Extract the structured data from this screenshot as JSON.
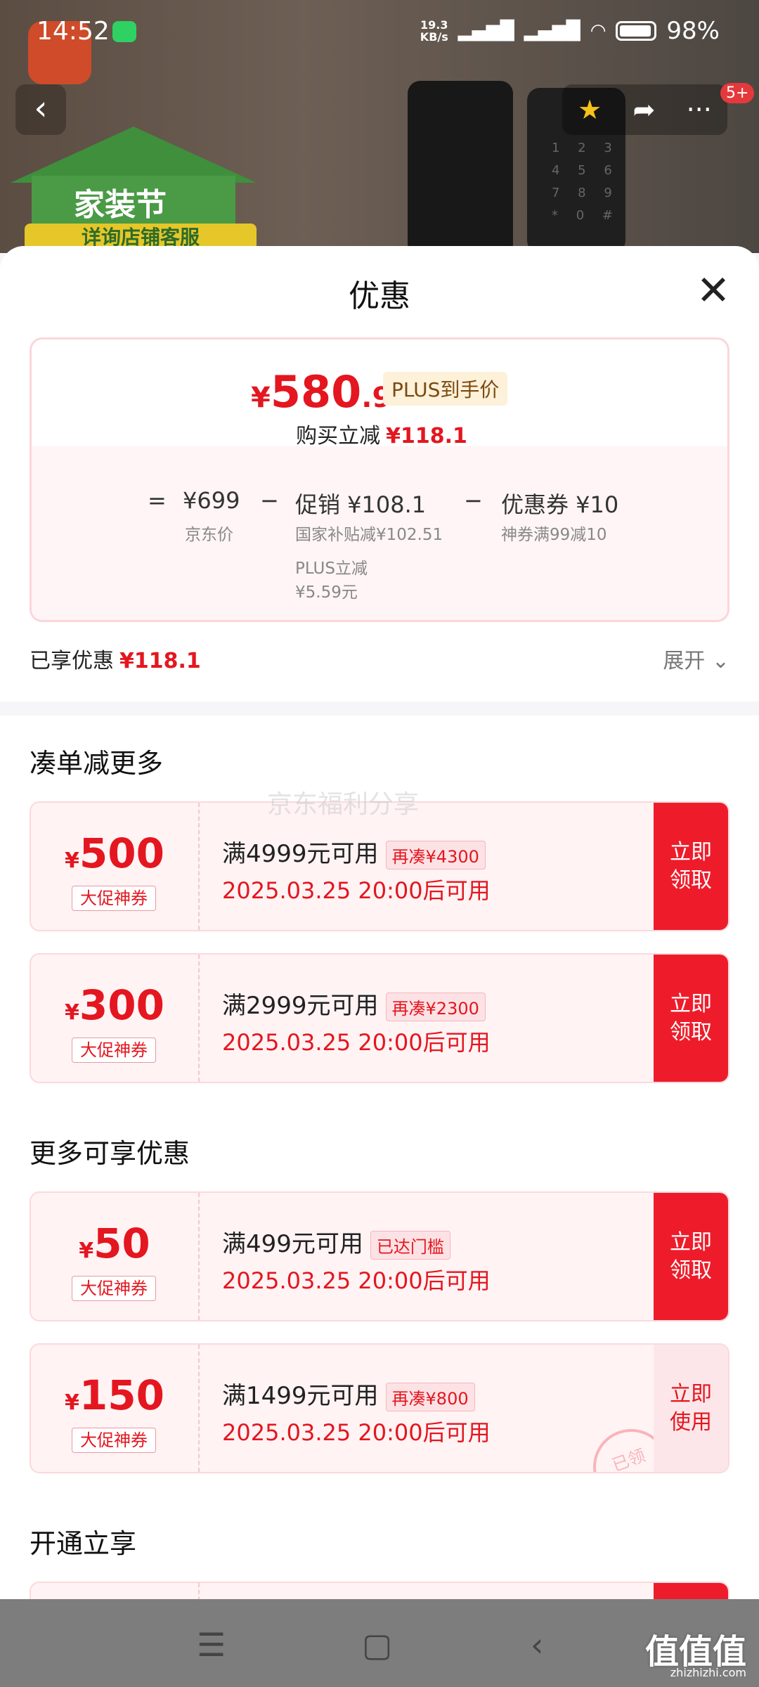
{
  "status_bar": {
    "time": "14:52",
    "speed_top": "19.3",
    "speed_bottom": "KB/s",
    "battery": "98%"
  },
  "background": {
    "banner_text": "家装节",
    "banner_band": "详询店铺客服"
  },
  "nav": {
    "back_icon": "‹",
    "more_icon": "···",
    "badge": "5+"
  },
  "sheet": {
    "title": "优惠",
    "close_icon": "✕",
    "price": {
      "symbol": "¥",
      "integer": "580",
      "decimal": ".9",
      "plus_tag": "PLUS到手价",
      "reduce_label": "购买立减",
      "reduce_value": "¥118.1"
    },
    "breakdown": {
      "eq": "=",
      "base_value": "¥699",
      "base_label": "京东价",
      "minus1": "−",
      "promo_title": "促销 ¥108.1",
      "promo_sub1": "国家补贴减¥102.51",
      "promo_sub2": "PLUS立减",
      "promo_sub3": "¥5.59元",
      "minus2": "−",
      "coupon_title": "优惠券 ¥10",
      "coupon_sub": "神券满99减10"
    },
    "enjoyed_label": "已享优惠",
    "enjoyed_value": "¥118.1",
    "expand_label": "展开 ⌄",
    "section1": "凑单减更多",
    "section2": "更多可享优惠",
    "section3": "开通立享",
    "watermark": "京东福利分享",
    "coupons": [
      {
        "symbol": "¥",
        "amount": "500",
        "tag": "大促神券",
        "condition": "满4999元可用",
        "need": "再凑¥4300",
        "date": "2025.03.25 20:00后可用",
        "btn": "立即\n领取"
      },
      {
        "symbol": "¥",
        "amount": "300",
        "tag": "大促神券",
        "condition": "满2999元可用",
        "need": "再凑¥2300",
        "date": "2025.03.25 20:00后可用",
        "btn": "立即\n领取"
      },
      {
        "symbol": "¥",
        "amount": "50",
        "tag": "大促神券",
        "condition": "满499元可用",
        "need": "已达门槛",
        "date": "2025.03.25 20:00后可用",
        "btn": "立即\n领取"
      },
      {
        "symbol": "¥",
        "amount": "150",
        "tag": "大促神券",
        "condition": "满1499元可用",
        "need": "再凑¥800",
        "date": "2025.03.25 20:00后可用",
        "btn": "立即\n使用",
        "stamp": "已领"
      }
    ]
  },
  "bottom_nav": {
    "menu_icon": "☰",
    "home_icon": "▢",
    "back_icon": "‹"
  },
  "site": {
    "logo": "值值值",
    "url": "zhizhizhi.com"
  }
}
